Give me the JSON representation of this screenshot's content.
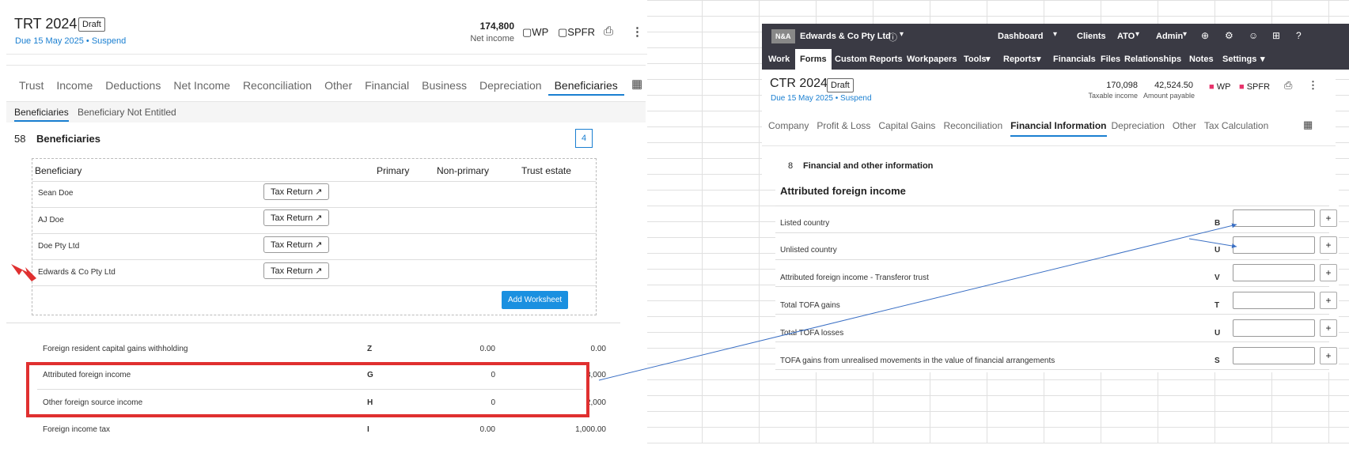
{
  "left": {
    "title": "TRT 2024",
    "status": "Draft",
    "due_prefix": "Due",
    "due_date": "15 May 2025",
    "dot": "•",
    "suspend": "Suspend",
    "net_income_value": "174,800",
    "net_income_label": "Net income",
    "wp": "WP",
    "spfr": "SPFR",
    "tabs": [
      "Trust",
      "Income",
      "Deductions",
      "Net Income",
      "Reconciliation",
      "Other",
      "Financial",
      "Business",
      "Depreciation",
      "Beneficiaries"
    ],
    "subtabs": [
      "Beneficiaries",
      "Beneficiary Not Entitled"
    ],
    "section_number": "58",
    "section_title": "Beneficiaries",
    "section_count": "4",
    "table_headers": [
      "Beneficiary",
      "Primary",
      "Non-primary",
      "Trust estate"
    ],
    "beneficiaries": [
      "Sean Doe",
      "AJ Doe",
      "Doe Pty Ltd",
      "Edwards & Co Pty Ltd"
    ],
    "tax_return_label": "Tax Return",
    "add_worksheet": "Add Worksheet",
    "income_rows": [
      {
        "label": "Foreign resident capital gains withholding",
        "code": "Z",
        "col1": "0.00",
        "col2": "0.00"
      },
      {
        "label": "Attributed foreign income",
        "code": "G",
        "col1": "0",
        "col2": "3,000"
      },
      {
        "label": "Other foreign source income",
        "code": "H",
        "col1": "0",
        "col2": "2,000"
      },
      {
        "label": "Foreign income tax",
        "code": "I",
        "col1": "0.00",
        "col2": "1,000.00"
      }
    ]
  },
  "right": {
    "logo": "N&A",
    "client": "Edwards & Co Pty Ltd",
    "top_menu": [
      "Dashboard",
      "Clients",
      "ATO",
      "Admin"
    ],
    "nav": [
      "Work",
      "Forms",
      "Custom Reports",
      "Workpapers",
      "Tools",
      "Reports",
      "Financials",
      "Files",
      "Relationships",
      "Notes",
      "Settings"
    ],
    "title": "CTR 2024",
    "status": "Draft",
    "due_prefix": "Due",
    "due_date": "15 May 2025",
    "dot": "•",
    "suspend": "Suspend",
    "taxable_income_value": "170,098",
    "taxable_income_label": "Taxable income",
    "amount_payable_value": "42,524.50",
    "amount_payable_label": "Amount payable",
    "wp": "WP",
    "spfr": "SPFR",
    "tabs": [
      "Company",
      "Profit & Loss",
      "Capital Gains",
      "Reconciliation",
      "Financial Information",
      "Depreciation",
      "Other",
      "Tax Calculation"
    ],
    "section_number": "8",
    "section_title": "Financial and other information",
    "afi_title": "Attributed foreign income",
    "afi_rows": [
      {
        "label": "Listed country",
        "code": "B"
      },
      {
        "label": "Unlisted country",
        "code": "U"
      },
      {
        "label": "Attributed foreign income - Transferor trust",
        "code": "V"
      },
      {
        "label": "Total TOFA gains",
        "code": "T"
      },
      {
        "label": "Total TOFA losses",
        "code": "U"
      },
      {
        "label": "TOFA gains from unrealised movements in the value of financial arrangements",
        "code": "S"
      }
    ],
    "plus": "+"
  },
  "colors": {
    "accent": "#1a7fd1",
    "highlight": "#e03030",
    "navbar": "#3a3a44",
    "flag": "#e8336b"
  }
}
